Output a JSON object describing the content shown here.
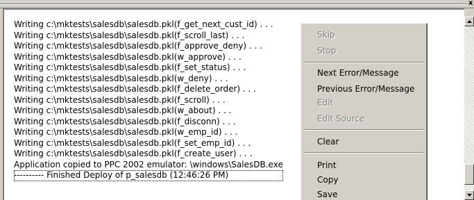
{
  "output": {
    "lines": [
      "Writing c:\\mktests\\salesdb\\salesdb.pkl(f_get_next_cust_id) . . .",
      "Writing c:\\mktests\\salesdb\\salesdb.pkl(f_scroll_last) . . .",
      "Writing c:\\mktests\\salesdb\\salesdb.pkl(f_approve_deny) . . .",
      "Writing c:\\mktests\\salesdb\\salesdb.pkl(w_approve) . . .",
      "Writing c:\\mktests\\salesdb\\salesdb.pkl(f_set_status) . . .",
      "Writing c:\\mktests\\salesdb\\salesdb.pkl(w_deny) . . .",
      "Writing c:\\mktests\\salesdb\\salesdb.pkl(f_delete_order) . . .",
      "Writing c:\\mktests\\salesdb\\salesdb.pkl(f_scroll) . . .",
      "Writing c:\\mktests\\salesdb\\salesdb.pkl(w_about) . . .",
      "Writing c:\\mktests\\salesdb\\salesdb.pkl(f_disconn) . . .",
      "Writing c:\\mktests\\salesdb\\salesdb.pkl(w_emp_id) . . .",
      "Writing c:\\mktests\\salesdb\\salesdb.pkl(f_set_emp_id) . . .",
      "Writing c:\\mktests\\salesdb\\salesdb.pkl(f_create_user) . . .",
      "Application copied to PPC 2002 emulator: \\windows\\SalesDB.exe",
      "---------- Finished Deploy of p_salesdb  (12:46:26 PM)"
    ]
  },
  "window": {
    "close_glyph": "x"
  },
  "context_menu": {
    "skip": "Skip",
    "stop": "Stop",
    "next_error": "Next Error/Message",
    "previous_error": "Previous Error/Message",
    "edit": "Edit",
    "edit_source": "Edit Source",
    "clear": "Clear",
    "print": "Print",
    "copy": "Copy",
    "save": "Save"
  },
  "colors": {
    "face": "#d4d0c8",
    "disabled_text": "#808080",
    "pane": "#ffffff"
  },
  "icons": {
    "scroll_up": "triangle-up-icon",
    "scroll_down": "triangle-down-icon"
  }
}
